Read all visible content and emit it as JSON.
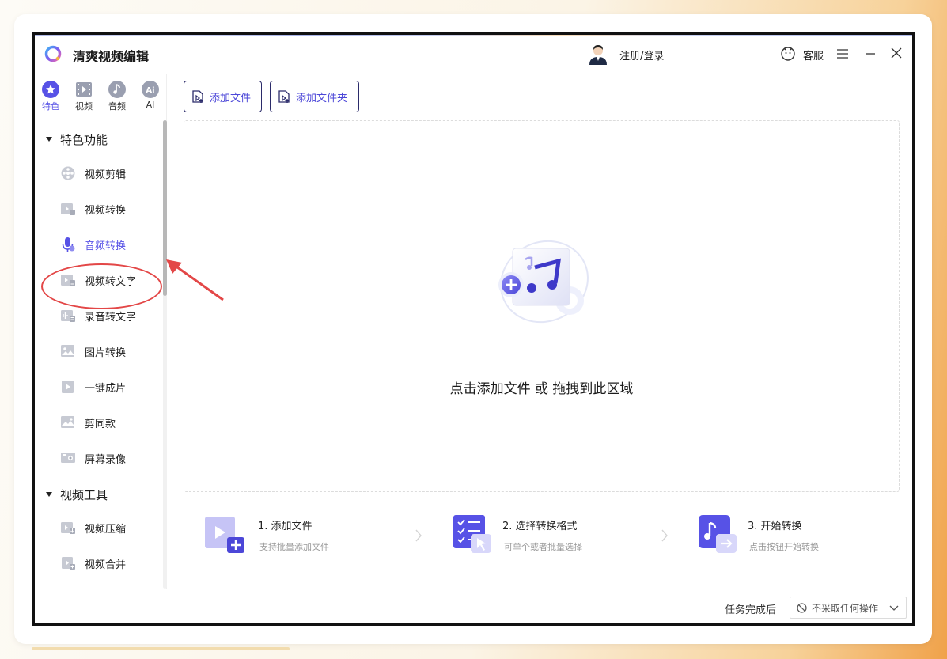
{
  "app": {
    "title": "清爽视频编辑"
  },
  "header": {
    "login_label": "注册/登录",
    "service_label": "客服"
  },
  "category_tabs": [
    {
      "label": "特色",
      "icon": "star-icon",
      "active": true
    },
    {
      "label": "视频",
      "icon": "film-icon",
      "active": false
    },
    {
      "label": "音频",
      "icon": "music-note-icon",
      "active": false
    },
    {
      "label": "AI",
      "icon": "ai-icon",
      "active": false
    }
  ],
  "groups": [
    {
      "title": "特色功能",
      "items": [
        {
          "label": "视频剪辑",
          "icon": "film-reel-icon"
        },
        {
          "label": "视频转换",
          "icon": "video-convert-icon"
        },
        {
          "label": "音频转换",
          "icon": "microphone-icon",
          "active": true
        },
        {
          "label": "视频转文字",
          "icon": "video-to-text-icon"
        },
        {
          "label": "录音转文字",
          "icon": "audio-to-text-icon"
        },
        {
          "label": "图片转换",
          "icon": "image-icon"
        },
        {
          "label": "一键成片",
          "icon": "play-document-icon"
        },
        {
          "label": "剪同款",
          "icon": "template-icon"
        },
        {
          "label": "屏幕录像",
          "icon": "screen-record-icon"
        }
      ]
    },
    {
      "title": "视频工具",
      "items": [
        {
          "label": "视频压缩",
          "icon": "video-compress-icon"
        },
        {
          "label": "视频合并",
          "icon": "video-merge-icon"
        }
      ]
    }
  ],
  "toolbar": {
    "add_file_label": "添加文件",
    "add_folder_label": "添加文件夹"
  },
  "dropzone": {
    "text": "点击添加文件 或 拖拽到此区域"
  },
  "steps": [
    {
      "title": "1. 添加文件",
      "subtitle": "支持批量添加文件",
      "icon": "add-file-step-icon"
    },
    {
      "title": "2. 选择转换格式",
      "subtitle": "可单个或者批量选择",
      "icon": "choose-format-step-icon"
    },
    {
      "title": "3. 开始转换",
      "subtitle": "点击按钮开始转换",
      "icon": "start-convert-step-icon"
    }
  ],
  "footer": {
    "after_task_label": "任务完成后",
    "after_task_value": "不采取任何操作"
  },
  "colors": {
    "accent": "#5752e6",
    "annotation": "#e34747"
  }
}
